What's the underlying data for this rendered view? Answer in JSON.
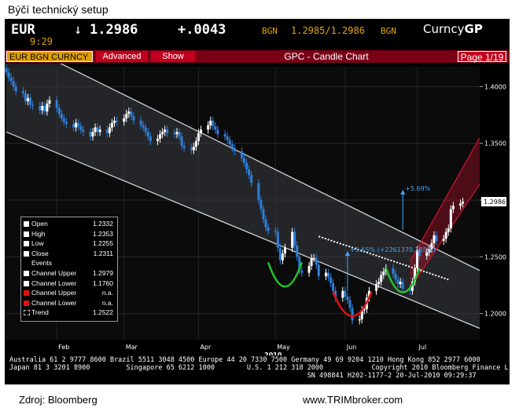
{
  "caption": "Býčí technický setup",
  "quote": {
    "symbol": "EUR",
    "arrow": "↓",
    "last": "1.2986",
    "change": "+.0043",
    "source1": "BGN",
    "bid_ask": "1.2985/1.2986",
    "source2": "BGN",
    "currency_prefix": "Curncy",
    "currency_code": "GP",
    "time": "9:29"
  },
  "toolbar": {
    "security": "EUR BGN CURNCY",
    "advanced": "Advanced",
    "show": "Show",
    "title": "GPC - Candle Chart",
    "page": "Page 1/19"
  },
  "colors": {
    "bg": "#000000",
    "up": "#ffffff",
    "down": "#2e7fd8",
    "channel": "#cfd2d6",
    "upper_channel": "#c8102e",
    "green_arc": "#22c22a",
    "red_arc": "#e01010",
    "annot": "#3fa8ff"
  },
  "chart_data": {
    "type": "candlestick",
    "ylim": [
      1.177,
      1.4175
    ],
    "y_ticks": [
      "1.4000",
      "1.3500",
      "1.3000",
      "1.2500",
      "1.2000"
    ],
    "y_tick_values": [
      1.4,
      1.35,
      1.3,
      1.25,
      1.2
    ],
    "x_ticks": [
      "Feb",
      "Mar",
      "Apr",
      "May",
      "Jun",
      "Jul"
    ],
    "x_tick_dates": [
      "2010-02-01",
      "2010-03-01",
      "2010-04-01",
      "2010-05-03",
      "2010-06-01",
      "2010-07-01"
    ],
    "x_range": [
      "2010-01-11",
      "2010-07-27"
    ],
    "year_label": "2010",
    "last_price_label": "1.2986",
    "dates": [
      "2010-01-11",
      "2010-01-12",
      "2010-01-13",
      "2010-01-14",
      "2010-01-15",
      "2010-01-18",
      "2010-01-19",
      "2010-01-20",
      "2010-01-21",
      "2010-01-22",
      "2010-01-25",
      "2010-01-26",
      "2010-01-27",
      "2010-01-28",
      "2010-01-29",
      "2010-02-01",
      "2010-02-02",
      "2010-02-03",
      "2010-02-04",
      "2010-02-05",
      "2010-02-08",
      "2010-02-09",
      "2010-02-10",
      "2010-02-11",
      "2010-02-12",
      "2010-02-15",
      "2010-02-16",
      "2010-02-17",
      "2010-02-18",
      "2010-02-19",
      "2010-02-22",
      "2010-02-23",
      "2010-02-24",
      "2010-02-25",
      "2010-02-26",
      "2010-03-01",
      "2010-03-02",
      "2010-03-03",
      "2010-03-04",
      "2010-03-05",
      "2010-03-08",
      "2010-03-09",
      "2010-03-10",
      "2010-03-11",
      "2010-03-12",
      "2010-03-15",
      "2010-03-16",
      "2010-03-17",
      "2010-03-18",
      "2010-03-19",
      "2010-03-22",
      "2010-03-23",
      "2010-03-24",
      "2010-03-25",
      "2010-03-26",
      "2010-03-29",
      "2010-03-30",
      "2010-03-31",
      "2010-04-01",
      "2010-04-02",
      "2010-04-05",
      "2010-04-06",
      "2010-04-07",
      "2010-04-08",
      "2010-04-09",
      "2010-04-12",
      "2010-04-13",
      "2010-04-14",
      "2010-04-15",
      "2010-04-16",
      "2010-04-19",
      "2010-04-20",
      "2010-04-21",
      "2010-04-22",
      "2010-04-23",
      "2010-04-26",
      "2010-04-27",
      "2010-04-28",
      "2010-04-29",
      "2010-04-30",
      "2010-05-03",
      "2010-05-04",
      "2010-05-05",
      "2010-05-06",
      "2010-05-07",
      "2010-05-10",
      "2010-05-11",
      "2010-05-12",
      "2010-05-13",
      "2010-05-14",
      "2010-05-17",
      "2010-05-18",
      "2010-05-19",
      "2010-05-20",
      "2010-05-21",
      "2010-05-24",
      "2010-05-25",
      "2010-05-26",
      "2010-05-27",
      "2010-05-28",
      "2010-05-31",
      "2010-06-01",
      "2010-06-02",
      "2010-06-03",
      "2010-06-04",
      "2010-06-07",
      "2010-06-08",
      "2010-06-09",
      "2010-06-10",
      "2010-06-11",
      "2010-06-14",
      "2010-06-15",
      "2010-06-16",
      "2010-06-17",
      "2010-06-18",
      "2010-06-21",
      "2010-06-22",
      "2010-06-23",
      "2010-06-24",
      "2010-06-25",
      "2010-06-28",
      "2010-06-29",
      "2010-06-30",
      "2010-07-01",
      "2010-07-02",
      "2010-07-05",
      "2010-07-06",
      "2010-07-07",
      "2010-07-08",
      "2010-07-09",
      "2010-07-12",
      "2010-07-13",
      "2010-07-14",
      "2010-07-15",
      "2010-07-16",
      "2010-07-19",
      "2010-07-20"
    ],
    "close": [
      1.4125,
      1.408,
      1.405,
      1.4,
      1.396,
      1.394,
      1.387,
      1.39,
      1.384,
      1.383,
      1.379,
      1.383,
      1.378,
      1.385,
      1.388,
      1.381,
      1.376,
      1.372,
      1.369,
      1.367,
      1.364,
      1.368,
      1.365,
      1.362,
      1.36,
      1.356,
      1.36,
      1.364,
      1.36,
      1.362,
      1.359,
      1.364,
      1.368,
      1.37,
      1.369,
      1.372,
      1.376,
      1.378,
      1.374,
      1.37,
      1.366,
      1.364,
      1.36,
      1.356,
      1.352,
      1.354,
      1.358,
      1.36,
      1.362,
      1.359,
      1.358,
      1.36,
      1.356,
      1.348,
      1.346,
      1.344,
      1.347,
      1.352,
      1.359,
      1.362,
      1.366,
      1.37,
      1.365,
      1.362,
      1.358,
      1.356,
      1.353,
      1.349,
      1.346,
      1.343,
      1.337,
      1.333,
      1.327,
      1.322,
      1.315,
      1.3,
      1.292,
      1.283,
      1.276,
      1.273,
      1.272,
      1.258,
      1.247,
      1.253,
      1.258,
      1.272,
      1.26,
      1.25,
      1.238,
      1.236,
      1.242,
      1.249,
      1.249,
      1.243,
      1.233,
      1.236,
      1.232,
      1.227,
      1.22,
      1.214,
      1.22,
      1.215,
      1.212,
      1.205,
      1.194,
      1.195,
      1.203,
      1.204,
      1.214,
      1.22,
      1.226,
      1.228,
      1.234,
      1.237,
      1.24,
      1.235,
      1.23,
      1.226,
      1.228,
      1.222,
      1.22,
      1.228,
      1.24,
      1.256,
      1.251,
      1.254,
      1.257,
      1.262,
      1.269,
      1.264,
      1.266,
      1.272,
      1.275,
      1.292,
      1.295,
      1.297,
      1.2986
    ],
    "open_high_low": "approximated from candle bodies; legend lists Open 1.2332, High 1.2353, Low 1.2255, Close 1.2311",
    "channel_lower_line": [
      [
        "2010-01-11",
        1.36
      ],
      [
        "2010-07-27",
        1.187
      ]
    ],
    "channel_upper_line": [
      [
        "2010-01-11",
        1.444
      ],
      [
        "2010-07-27",
        1.238
      ]
    ],
    "channel_mid_line": [
      [
        "2010-01-11",
        1.402
      ],
      [
        "2010-07-27",
        1.212
      ]
    ],
    "uptrend_channel_upper": [
      [
        "2010-06-28",
        1.246
      ],
      [
        "2010-07-27",
        1.355
      ]
    ],
    "uptrend_channel_lower": [
      [
        "2010-06-28",
        1.222
      ],
      [
        "2010-07-27",
        1.314
      ]
    ],
    "trend_dotted": [
      [
        "2010-05-21",
        1.268
      ],
      [
        "2010-07-14",
        1.23
      ]
    ],
    "arc_green_left": {
      "center": [
        "2010-05-07",
        1.23
      ],
      "span_days": 14
    },
    "arc_red_mid": {
      "center": [
        "2010-06-04",
        1.204
      ],
      "span_days": 16
    },
    "arc_green_right": {
      "center": [
        "2010-06-25",
        1.225
      ],
      "span_days": 14
    },
    "annotations": [
      {
        "text": "+5.65% (+2261370.165%)",
        "date": "2010-06-02",
        "price": 1.253
      },
      {
        "text": "+5.69%",
        "date": "2010-06-25",
        "price": 1.307
      }
    ]
  },
  "legend": [
    {
      "label": "Open",
      "value": "1.2332",
      "swatch": "#ffffff"
    },
    {
      "label": "High",
      "value": "1.2353",
      "swatch": "#ffffff"
    },
    {
      "label": "Low",
      "value": "1.2255",
      "swatch": "#ffffff"
    },
    {
      "label": "Close",
      "value": "1.2311",
      "swatch": "#ffffff"
    },
    {
      "label": "Events",
      "value": "",
      "swatch": ""
    },
    {
      "label": "Channel Upper",
      "value": "1.2979",
      "swatch": "#ffffff"
    },
    {
      "label": "Channel Lower",
      "value": "1.1760",
      "swatch": "#ffffff"
    },
    {
      "label": "Channel Upper",
      "value": "n.a.",
      "swatch": "#e01010"
    },
    {
      "label": "Channel Lower",
      "value": "n.a.",
      "swatch": "#e01010"
    },
    {
      "label": "Trend",
      "value": "1.2522",
      "swatch": "#777777"
    }
  ],
  "footer": {
    "line1": "Australia 61 2 9777 8600 Brazil 5511 3048 4500 Europe 44 20 7330 7500 Germany 49 69 9204 1210 Hong Kong 852 2977 6000",
    "line2": "Japan 81 3 3201 8900         Singapore 65 6212 1000        U.S. 1 212 318 2000            Copyright 2010 Bloomberg Finance L.P.",
    "line3": "                                                                          SN 498841 H202-1177-2 20-Jul-2010 09:29:37"
  },
  "source": "Zdroj: Bloomberg",
  "website": "www.TRIMbroker.com"
}
